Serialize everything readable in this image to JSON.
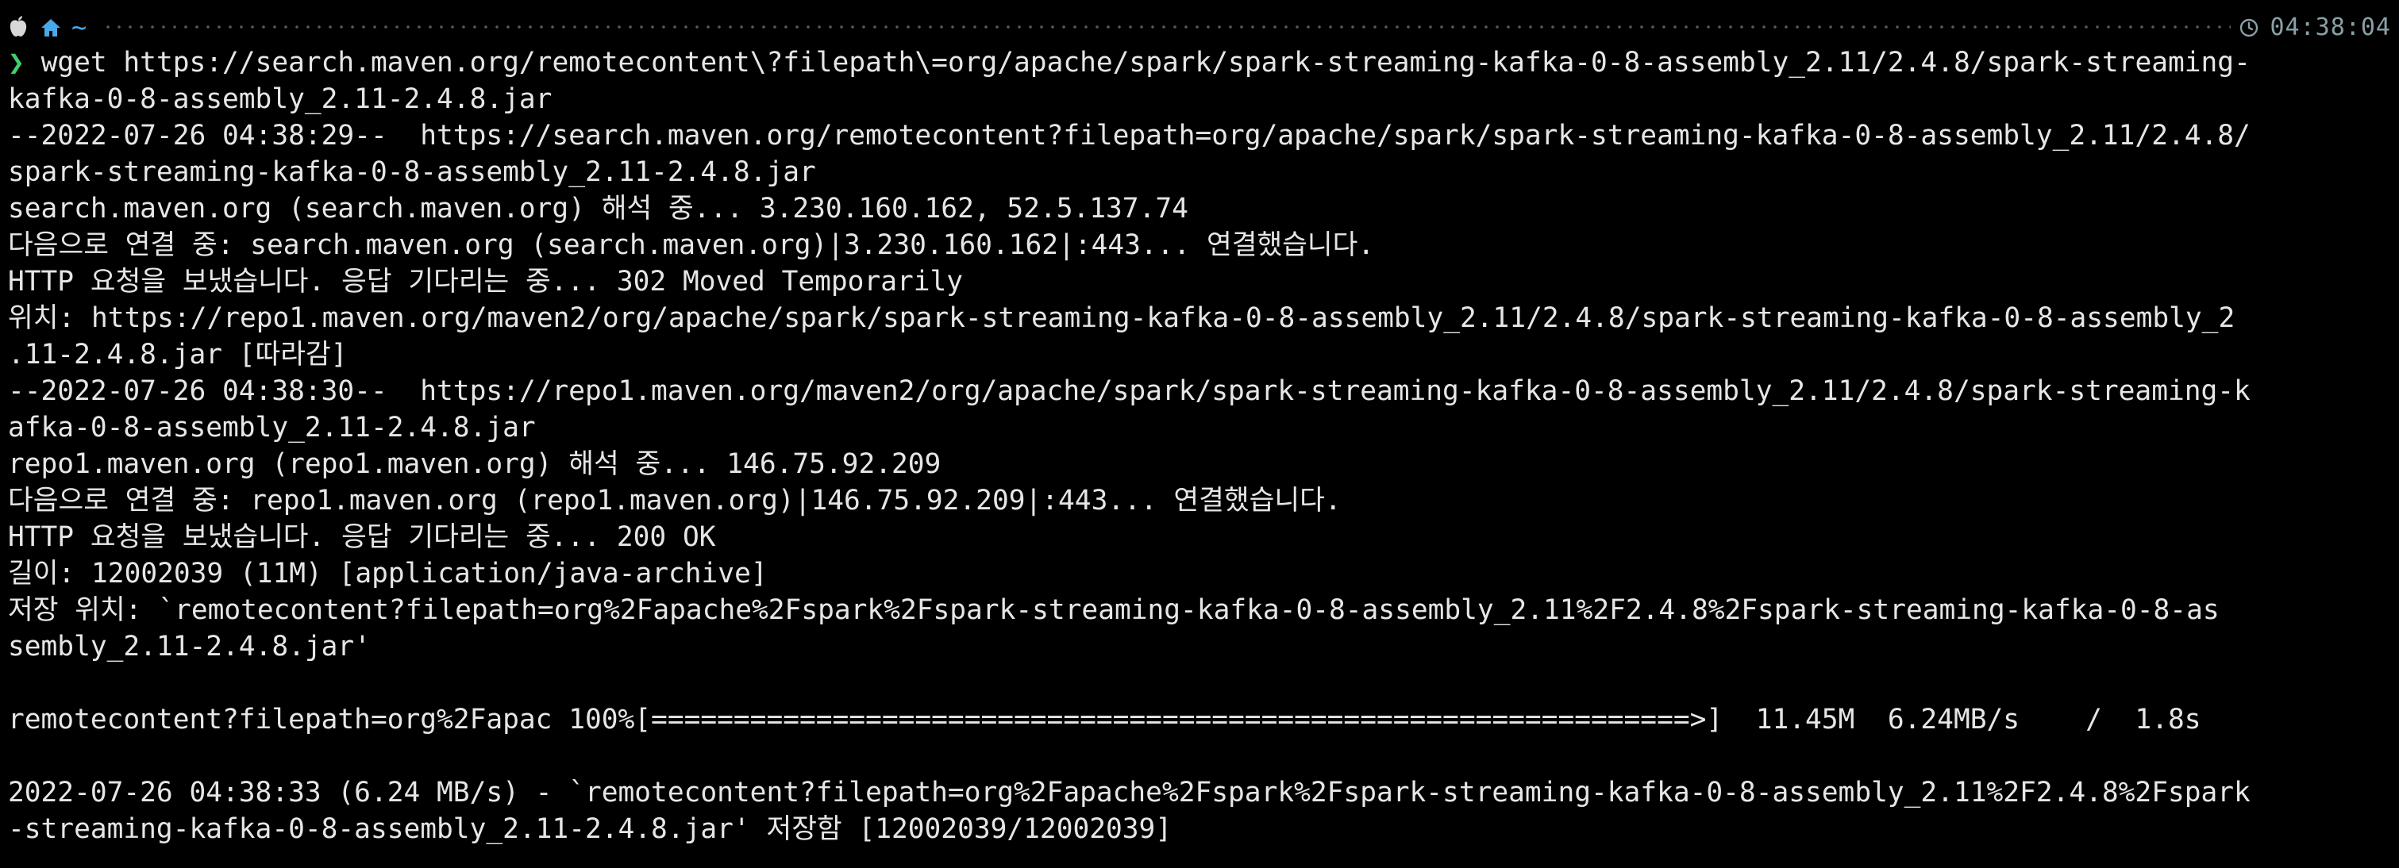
{
  "prompt": {
    "cwd_symbol": "~",
    "time": "04:38:04",
    "chevron": "❯"
  },
  "colors": {
    "background": "#000000",
    "text": "#e6e6e6",
    "accent_blue": "#4aa8e8",
    "prompt_green": "#3fd06a",
    "time_gray": "#8aa0a6"
  },
  "icons": [
    "apple-icon",
    "home-icon",
    "clock-icon"
  ],
  "lines": [
    "wget https://search.maven.org/remotecontent\\?filepath\\=org/apache/spark/spark-streaming-kafka-0-8-assembly_2.11/2.4.8/spark-streaming-",
    "kafka-0-8-assembly_2.11-2.4.8.jar",
    "--2022-07-26 04:38:29--  https://search.maven.org/remotecontent?filepath=org/apache/spark/spark-streaming-kafka-0-8-assembly_2.11/2.4.8/",
    "spark-streaming-kafka-0-8-assembly_2.11-2.4.8.jar",
    "search.maven.org (search.maven.org) 해석 중... 3.230.160.162, 52.5.137.74",
    "다음으로 연결 중: search.maven.org (search.maven.org)|3.230.160.162|:443... 연결했습니다.",
    "HTTP 요청을 보냈습니다. 응답 기다리는 중... 302 Moved Temporarily",
    "위치: https://repo1.maven.org/maven2/org/apache/spark/spark-streaming-kafka-0-8-assembly_2.11/2.4.8/spark-streaming-kafka-0-8-assembly_2",
    ".11-2.4.8.jar [따라감]",
    "--2022-07-26 04:38:30--  https://repo1.maven.org/maven2/org/apache/spark/spark-streaming-kafka-0-8-assembly_2.11/2.4.8/spark-streaming-k",
    "afka-0-8-assembly_2.11-2.4.8.jar",
    "repo1.maven.org (repo1.maven.org) 해석 중... 146.75.92.209",
    "다음으로 연결 중: repo1.maven.org (repo1.maven.org)|146.75.92.209|:443... 연결했습니다.",
    "HTTP 요청을 보냈습니다. 응답 기다리는 중... 200 OK",
    "길이: 12002039 (11M) [application/java-archive]",
    "저장 위치: `remotecontent?filepath=org%2Fapache%2Fspark%2Fspark-streaming-kafka-0-8-assembly_2.11%2F2.4.8%2Fspark-streaming-kafka-0-8-as",
    "sembly_2.11-2.4.8.jar'",
    "",
    "remotecontent?filepath=org%2Fapac 100%[===============================================================>]  11.45M  6.24MB/s    /  1.8s",
    "",
    "2022-07-26 04:38:33 (6.24 MB/s) - `remotecontent?filepath=org%2Fapache%2Fspark%2Fspark-streaming-kafka-0-8-assembly_2.11%2F2.4.8%2Fspark",
    "-streaming-kafka-0-8-assembly_2.11-2.4.8.jar' 저장함 [12002039/12002039]"
  ]
}
